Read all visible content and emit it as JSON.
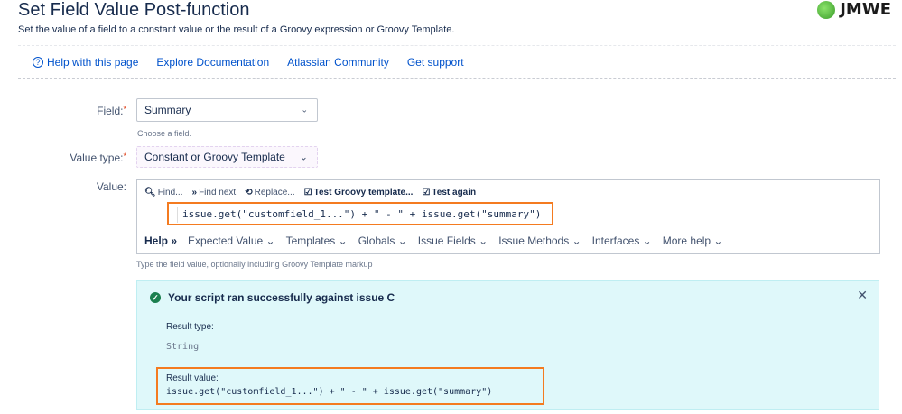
{
  "header": {
    "title": "Set Field Value Post-function",
    "subtitle": "Set the value of a field to a constant value or the result of a Groovy expression or Groovy Template.",
    "brand": "JMWE"
  },
  "help_bar": {
    "help_label": "Help with this page",
    "links": [
      "Explore Documentation",
      "Atlassian Community",
      "Get support"
    ]
  },
  "form": {
    "field": {
      "label": "Field:",
      "value": "Summary",
      "hint": "Choose a field."
    },
    "value_type": {
      "label": "Value type:",
      "value": "Constant or Groovy Template"
    },
    "value": {
      "label": "Value:",
      "toolbar": [
        "Find...",
        "Find next",
        "Replace...",
        "Test Groovy template...",
        "Test again"
      ],
      "code": "issue.get(\"customfield_1...\") + \" - \" + issue.get(\"summary\")",
      "help_nav": {
        "help": "Help",
        "items": [
          "Expected Value",
          "Templates",
          "Globals",
          "Issue Fields",
          "Issue Methods",
          "Interfaces",
          "More help"
        ]
      },
      "hint": "Type the field value, optionally including Groovy Template markup"
    }
  },
  "result": {
    "message": "Your script ran successfully against issue C",
    "result_type_label": "Result type:",
    "result_type_value": "String",
    "result_value_label": "Result value:",
    "result_value": "issue.get(\"customfield_1...\") + \" - \" + issue.get(\"summary\")"
  },
  "colors": {
    "accent": "#0052cc",
    "highlight_border": "#f47b20",
    "success_bg": "#dff8fa"
  }
}
